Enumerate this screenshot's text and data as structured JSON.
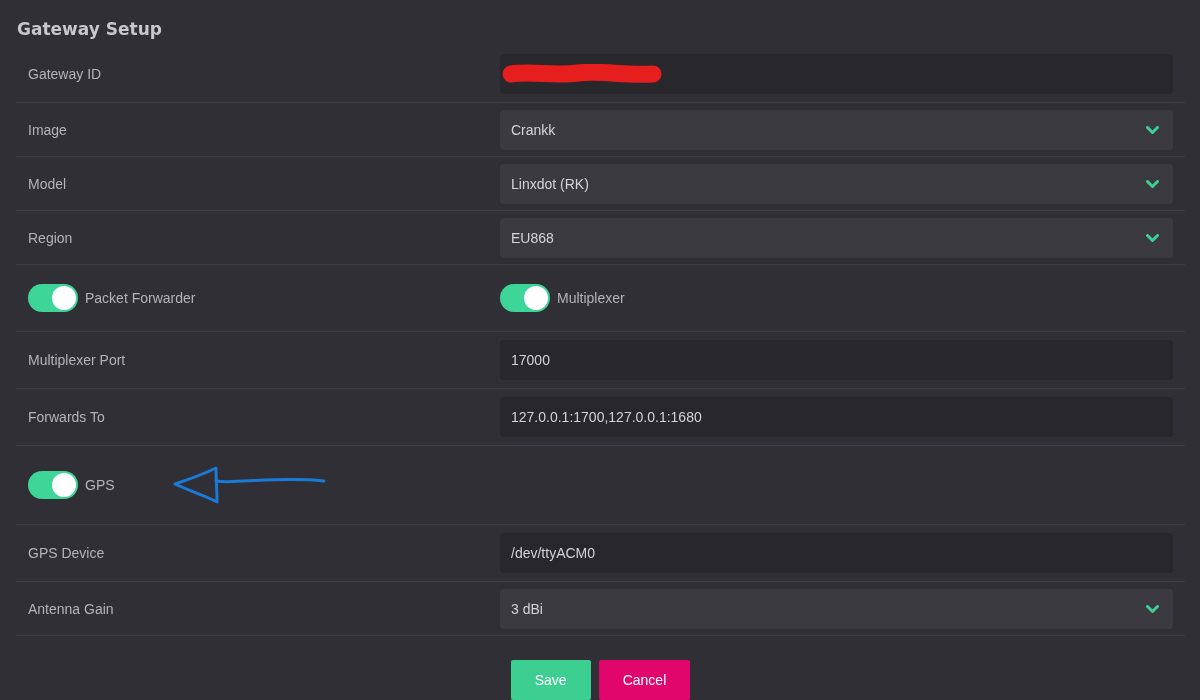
{
  "title": "Gateway Setup",
  "rows": [
    {
      "kind": "input",
      "label": "Gateway ID",
      "redacted": true
    },
    {
      "kind": "select",
      "label": "Image",
      "value": "Crankk"
    },
    {
      "kind": "select",
      "label": "Model",
      "value": "Linxdot (RK)"
    },
    {
      "kind": "select",
      "label": "Region",
      "value": "EU868"
    },
    {
      "kind": "toggles",
      "toggles": [
        {
          "label": "Packet Forwarder",
          "on": true
        },
        {
          "label": "Multiplexer",
          "on": true
        }
      ]
    },
    {
      "kind": "input",
      "label": "Multiplexer Port",
      "value": "17000"
    },
    {
      "kind": "input",
      "label": "Forwards To",
      "value": "127.0.0.1:1700,127.0.0.1:1680"
    },
    {
      "kind": "toggles",
      "toggles": [
        {
          "label": "GPS",
          "on": true
        }
      ],
      "arrow_annotation": true
    },
    {
      "kind": "input",
      "label": "GPS Device",
      "value": "/dev/ttyACM0"
    },
    {
      "kind": "select",
      "label": "Antenna Gain",
      "value": "3 dBi"
    }
  ],
  "buttons": [
    {
      "kind": "save",
      "label": "Save"
    },
    {
      "kind": "cancel",
      "label": "Cancel"
    }
  ]
}
